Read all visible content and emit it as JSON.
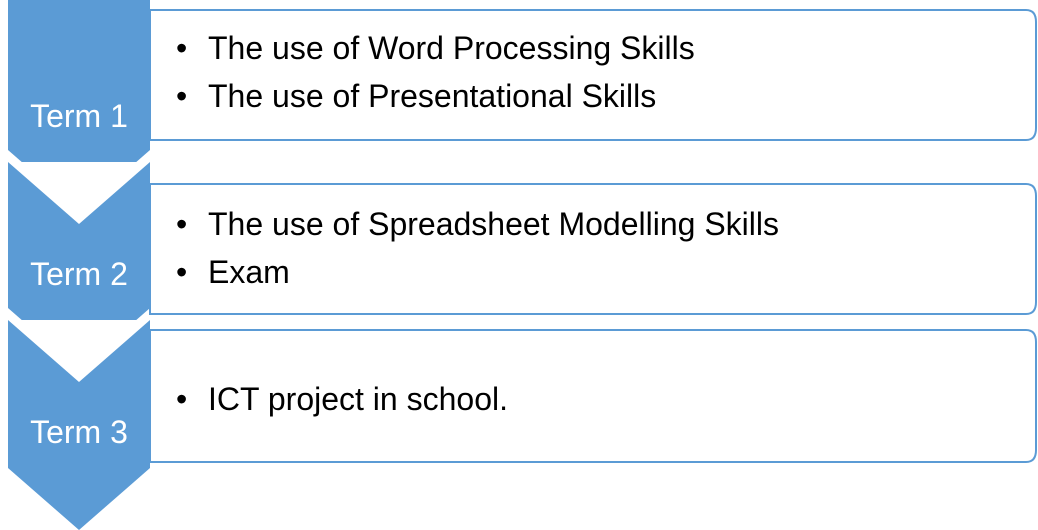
{
  "colors": {
    "chevron_fill": "#5b9bd5",
    "panel_border": "#5b9bd5",
    "panel_fill": "#ffffff",
    "label_text": "#ffffff",
    "bullet_text": "#000000"
  },
  "terms": [
    {
      "label": "Term 1",
      "bullets": [
        "The use of Word Processing Skills",
        "The use of Presentational Skills"
      ]
    },
    {
      "label": "Term 2",
      "bullets": [
        "The use of Spreadsheet Modelling Skills",
        "Exam"
      ]
    },
    {
      "label": "Term 3",
      "bullets": [
        "ICT project in school."
      ]
    }
  ]
}
